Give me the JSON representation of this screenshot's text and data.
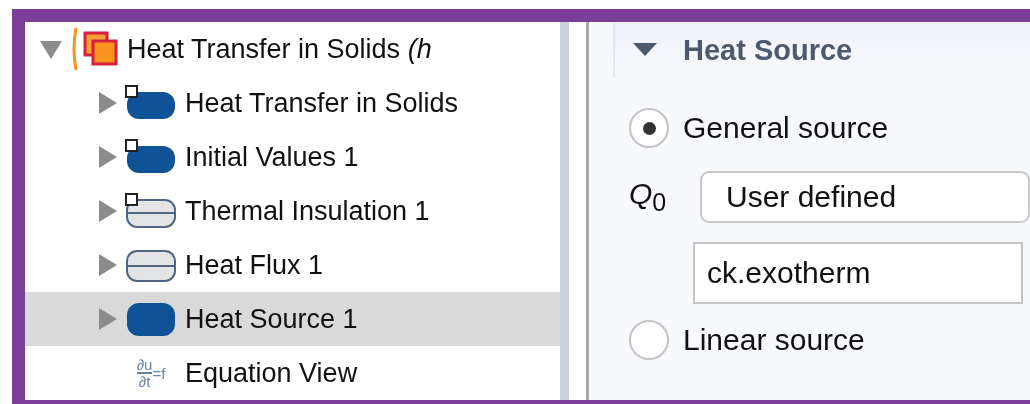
{
  "tree": [
    {
      "label": "Heat Transfer in Solids *(h*",
      "kind": "physics",
      "expanded": true,
      "selected": false,
      "children": [
        {
          "label": "Heat Transfer in Solids",
          "kind": "domain_default",
          "expanded": false,
          "selected": false
        },
        {
          "label": "Initial Values 1",
          "kind": "domain_default",
          "expanded": false,
          "selected": false
        },
        {
          "label": "Thermal Insulation 1",
          "kind": "boundary_default",
          "expanded": false,
          "selected": false
        },
        {
          "label": "Heat Flux 1",
          "kind": "boundary",
          "expanded": false,
          "selected": false
        },
        {
          "label": "Heat Source 1",
          "kind": "domain",
          "expanded": false,
          "selected": true
        },
        {
          "label": "Equation View",
          "kind": "equation",
          "selected": false,
          "icon_text": {
            "numerator": "∂u",
            "denominator": "∂t",
            "rhs": "=f"
          }
        }
      ]
    }
  ],
  "settings": {
    "section": {
      "title": "Heat Source",
      "expanded": true
    },
    "options": [
      {
        "label": "General source",
        "selected": true
      },
      {
        "label": "Linear source",
        "selected": false
      }
    ],
    "source_label": "*Q*$_{0}$",
    "source_dropdown": {
      "value": "User defined"
    },
    "source_expression": {
      "value": "ck.exotherm"
    }
  }
}
